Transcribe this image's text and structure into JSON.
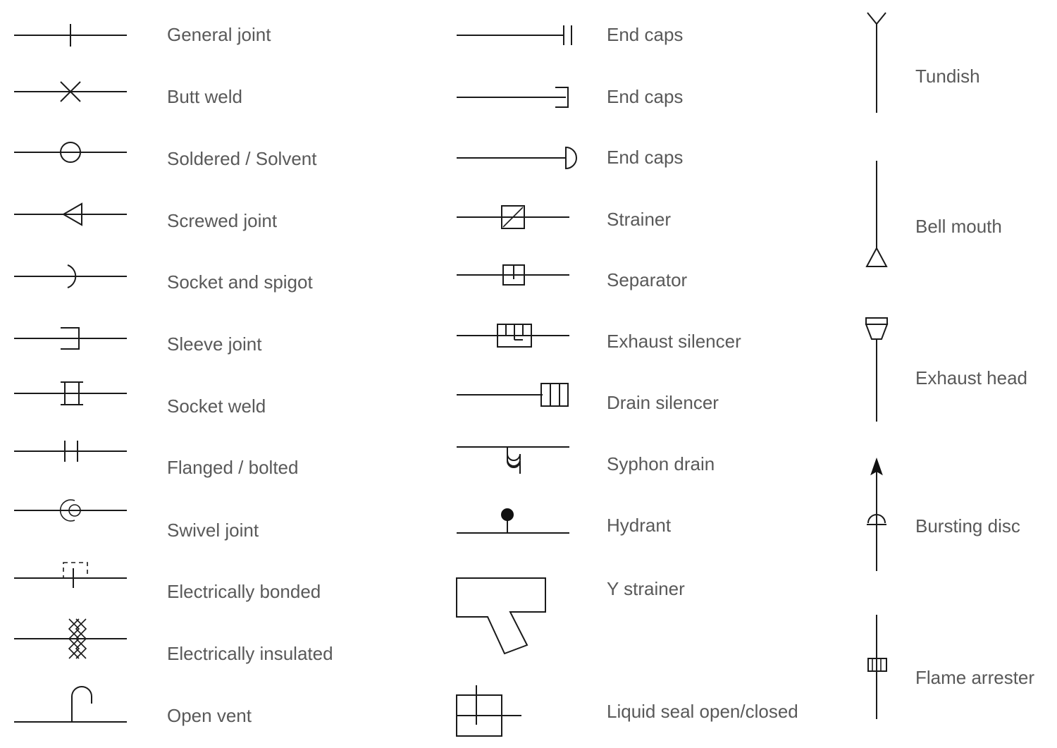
{
  "document": {
    "kind": "piping-symbols-legend",
    "background_color": "#ffffff",
    "line_color": "#1a1a1a",
    "label_color": "#595959",
    "columns": 3
  },
  "columns": [
    {
      "name": "joints-and-fittings",
      "items": [
        {
          "label": "General joint",
          "icon": "general-joint-symbol"
        },
        {
          "label": "Butt weld",
          "icon": "butt-weld-symbol"
        },
        {
          "label": "Soldered / Solvent",
          "icon": "soldered-solvent-symbol"
        },
        {
          "label": "Screwed joint",
          "icon": "screwed-joint-symbol"
        },
        {
          "label": "Socket and spigot",
          "icon": "socket-and-spigot-symbol"
        },
        {
          "label": "Sleeve joint",
          "icon": "sleeve-joint-symbol"
        },
        {
          "label": "Socket weld",
          "icon": "socket-weld-symbol"
        },
        {
          "label": "Flanged / bolted",
          "icon": "flanged-bolted-symbol"
        },
        {
          "label": "Swivel joint",
          "icon": "swivel-joint-symbol"
        },
        {
          "label": "Electrically bonded",
          "icon": "electrically-bonded-symbol"
        },
        {
          "label": "Electrically insulated",
          "icon": "electrically-insulated-symbol"
        },
        {
          "label": "Open vent",
          "icon": "open-vent-symbol"
        }
      ]
    },
    {
      "name": "end-caps-and-inline-devices",
      "items": [
        {
          "label": "End caps",
          "icon": "end-cap-double-bar-symbol"
        },
        {
          "label": "End caps",
          "icon": "end-cap-square-symbol"
        },
        {
          "label": "End caps",
          "icon": "end-cap-round-symbol"
        },
        {
          "label": "Strainer",
          "icon": "strainer-symbol"
        },
        {
          "label": "Separator",
          "icon": "separator-symbol"
        },
        {
          "label": "Exhaust silencer",
          "icon": "exhaust-silencer-symbol"
        },
        {
          "label": "Drain silencer",
          "icon": "drain-silencer-symbol"
        },
        {
          "label": "Syphon drain",
          "icon": "syphon-drain-symbol"
        },
        {
          "label": "Hydrant",
          "icon": "hydrant-symbol"
        },
        {
          "label": "Y strainer",
          "icon": "y-strainer-symbol"
        },
        {
          "label": "Liquid seal open/closed",
          "icon": "liquid-seal-symbol"
        }
      ]
    },
    {
      "name": "vertical-line-devices",
      "items": [
        {
          "label": "Tundish",
          "icon": "tundish-symbol"
        },
        {
          "label": "Bell mouth",
          "icon": "bell-mouth-symbol"
        },
        {
          "label": "Exhaust head",
          "icon": "exhaust-head-symbol"
        },
        {
          "label": "Bursting disc",
          "icon": "bursting-disc-symbol"
        },
        {
          "label": "Flame arrester",
          "icon": "flame-arrester-symbol"
        }
      ]
    }
  ]
}
